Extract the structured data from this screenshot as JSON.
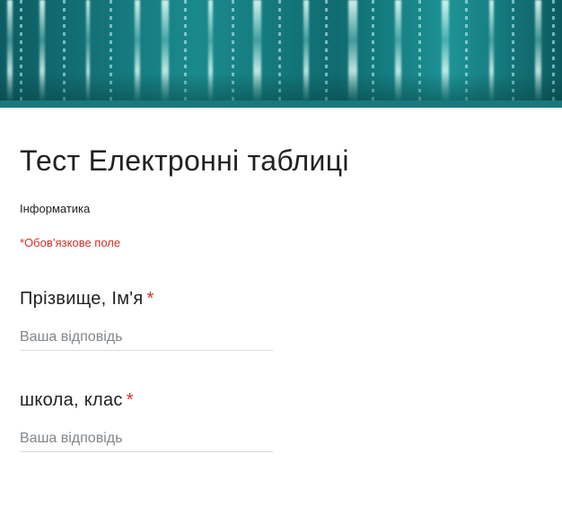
{
  "form": {
    "title": "Тест Електронні таблиці",
    "description": "Інформатика",
    "required_note": "*Обов’язкове поле"
  },
  "questions": [
    {
      "label": "Прізвище, Ім'я",
      "required_mark": "*",
      "placeholder": "Ваша відповідь",
      "value": ""
    },
    {
      "label": "школа, клас",
      "required_mark": "*",
      "placeholder": "Ваша відповідь",
      "value": ""
    }
  ],
  "colors": {
    "theme": "#17797e",
    "required": "#d93025",
    "text": "#202124",
    "placeholder": "#80868b"
  }
}
